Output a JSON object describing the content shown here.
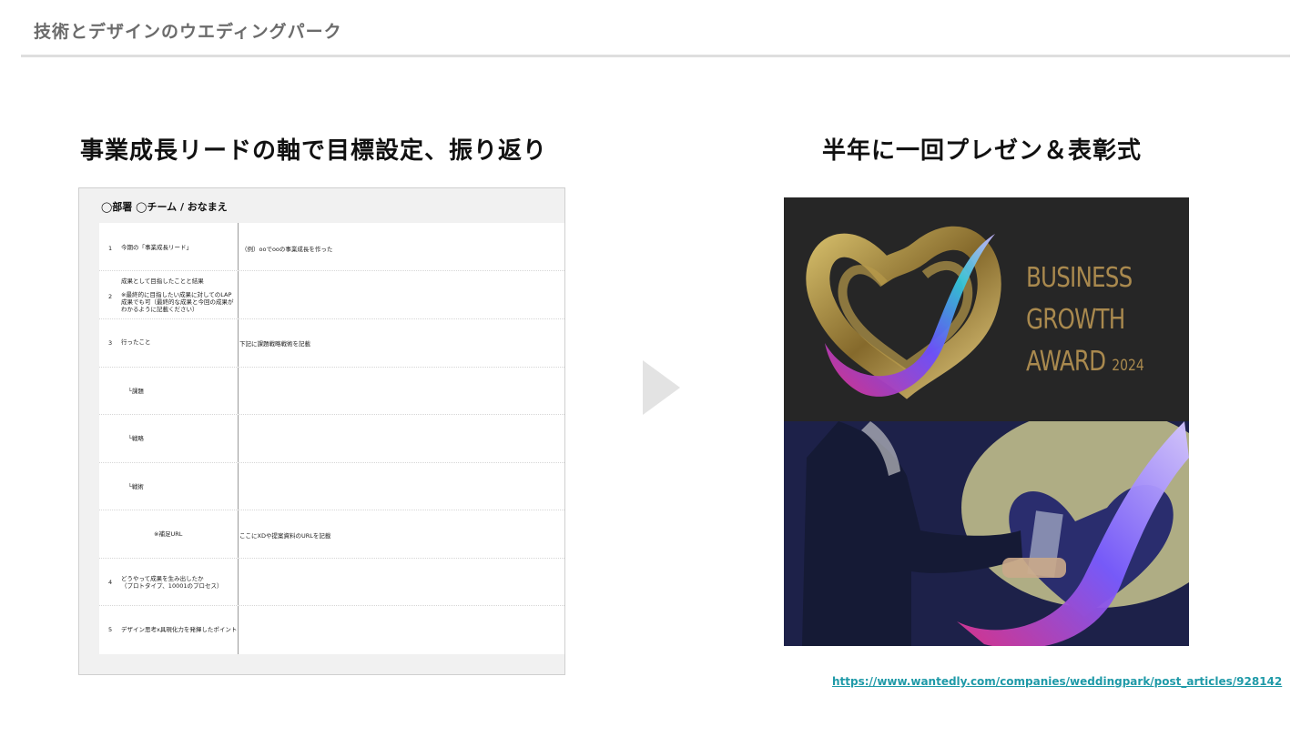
{
  "header": {
    "title": "技術とデザインのウエディングパーク"
  },
  "left": {
    "heading": "事業成長リードの軸で目標設定、振り返り",
    "sheet": {
      "title": "◯部署 ◯チーム / おなまえ",
      "rows": [
        {
          "num": "1",
          "label": "今期の「事業成長リード」",
          "value": "（例）ooでooの事業成長を作った"
        },
        {
          "num": "2",
          "label": "成果として目指したことと結果",
          "label2": "※最終的に目指したい成果に対してのLAP",
          "label3": "成果でも可（最終的な成果と今回の成果が",
          "label4": "わかるように記載ください）",
          "value": ""
        },
        {
          "num": "3",
          "label": "行ったこと",
          "value": "下記に課題戦略戦術を記載"
        },
        {
          "num": "",
          "label": "└課題",
          "value": ""
        },
        {
          "num": "",
          "label": "└戦略",
          "value": ""
        },
        {
          "num": "",
          "label": "└戦術",
          "value": ""
        },
        {
          "num": "",
          "label": "※補足URL",
          "value": "ここにXDや提案資料のURLを記載"
        },
        {
          "num": "4",
          "label": "どうやって成果を生み出したか",
          "label2": "（プロトタイプ、10001のプロセス）",
          "value": ""
        },
        {
          "num": "5",
          "label": "デザイン思考x具現化力を発揮したポイント",
          "value": ""
        }
      ]
    }
  },
  "right": {
    "heading": "半年に一回プレゼン＆表彰式",
    "award_lines": [
      "BUSINESS",
      "GROWTH",
      "AWARD"
    ],
    "award_year": "2024",
    "link": "https://www.wantedly.com/companies/weddingpark/post_articles/928142"
  },
  "colors": {
    "award_gold": "#a9894e",
    "link": "#1f9aa8",
    "header_gray": "#6b6b6b"
  },
  "icons": {
    "arrow": "play-arrow-icon"
  }
}
